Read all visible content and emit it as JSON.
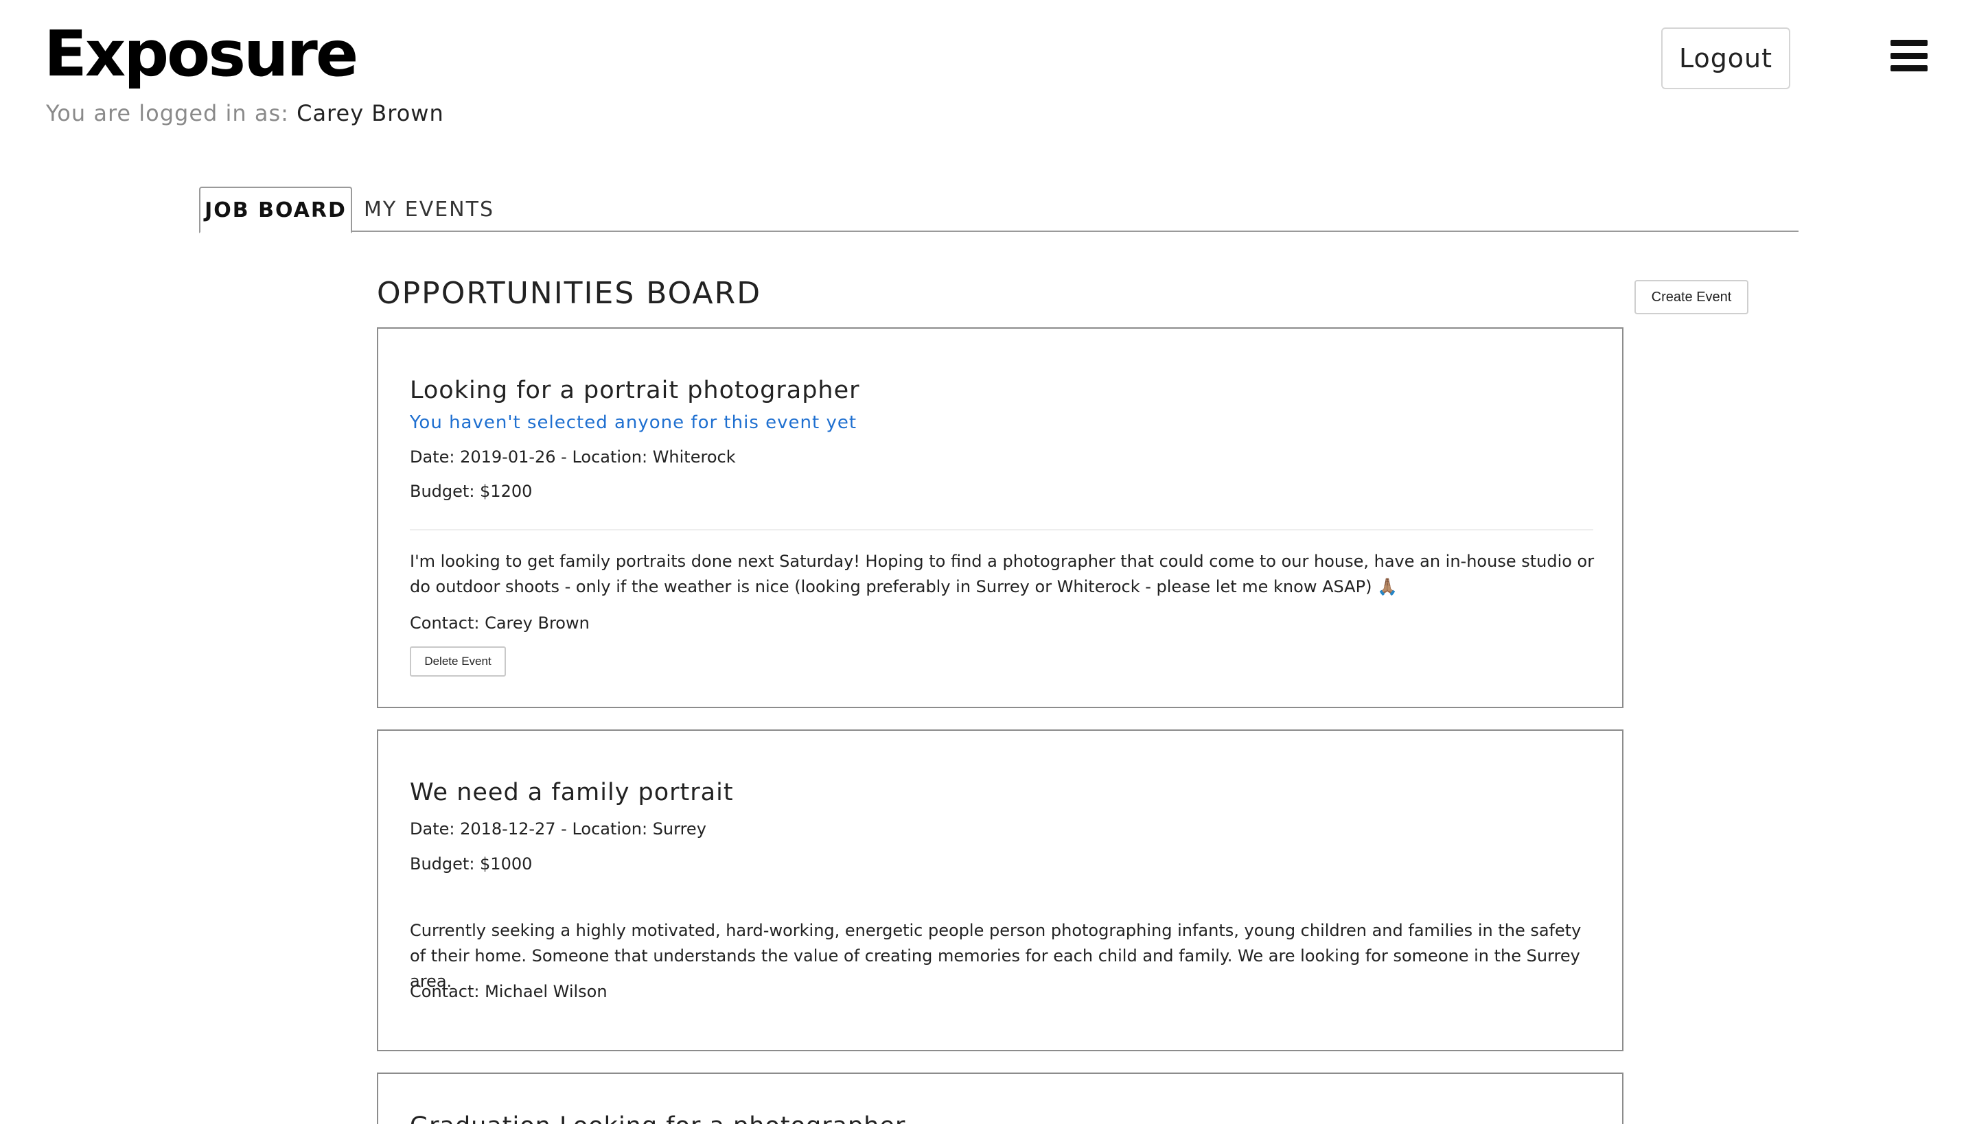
{
  "header": {
    "logo": "Exposure",
    "logged_in_prefix": "You are logged in as:",
    "user_name": "Carey Brown",
    "logout_label": "Logout",
    "menu_icon": "hamburger-menu-icon"
  },
  "tabs": [
    {
      "label": "JOB BOARD",
      "active": true
    },
    {
      "label": "MY EVENTS",
      "active": false
    }
  ],
  "board": {
    "title": "OPPORTUNITIES BOARD",
    "create_label": "Create Event"
  },
  "events": [
    {
      "title": "Looking for a portrait photographer",
      "status": "You haven't selected anyone for this event yet",
      "date_location": "Date: 2019-01-26 - Location: Whiterock",
      "budget": "Budget: $1200",
      "description": "I'm looking to get family portraits done next Saturday! Hoping to find a photographer that could come to our house, have an in-house studio or do outdoor shoots - only if the weather is nice (looking preferably in Surrey or Whiterock - please let me know ASAP) 🙏🏽",
      "contact": "Contact: Carey Brown",
      "delete_label": "Delete Event"
    },
    {
      "title": "We need a family portrait",
      "date_location": "Date: 2018-12-27 - Location: Surrey",
      "budget": "Budget: $1000",
      "description": "Currently seeking a highly motivated, hard-working, energetic people person photographing infants, young children and families in the safety of their home. Someone that understands the value of creating memories for each child and family. We are looking for someone in the Surrey area.",
      "contact": "Contact: Michael Wilson"
    },
    {
      "title": "Graduation Looking for a photographer"
    }
  ],
  "colors": {
    "status_link": "#1e6fd0",
    "card_border": "#8c8c8c"
  }
}
